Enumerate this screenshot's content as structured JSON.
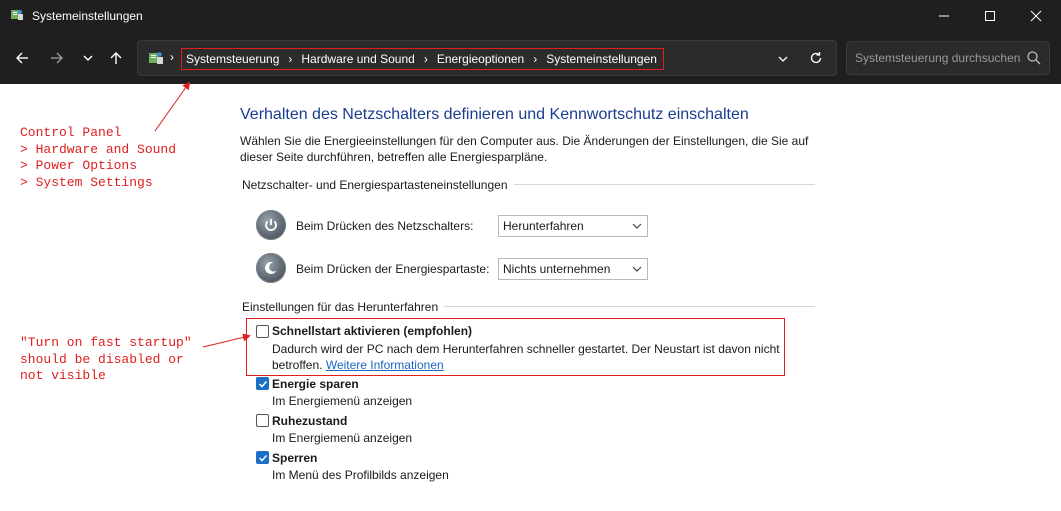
{
  "window": {
    "title": "Systemeinstellungen"
  },
  "address": {
    "crumbs": [
      "Systemsteuerung",
      "Hardware und Sound",
      "Energieoptionen",
      "Systemeinstellungen"
    ],
    "search_placeholder": "Systemsteuerung durchsuchen"
  },
  "annotations": {
    "breadcrumb_note": "Control Panel\n> Hardware and Sound\n> Power Options\n> System Settings",
    "fast_startup_note": "\"Turn on fast startup\"\nshould be disabled or\nnot visible",
    "color": "#e01e1e"
  },
  "main": {
    "heading": "Verhalten des Netzschalters definieren und Kennwortschutz einschalten",
    "description": "Wählen Sie die Energieeinstellungen für den Computer aus. Die Änderungen der Einstellungen, die Sie auf dieser Seite durchführen, betreffen alle Energiesparpläne.",
    "buttons_section": {
      "title": "Netzschalter- und Energiespartasteneinstellungen",
      "rows": [
        {
          "label": "Beim Drücken des Netzschalters:",
          "value": "Herunterfahren",
          "icon": "power-button-icon"
        },
        {
          "label": "Beim Drücken der Energiespartaste:",
          "value": "Nichts unternehmen",
          "icon": "sleep-button-icon"
        }
      ]
    },
    "shutdown_section": {
      "title": "Einstellungen für das Herunterfahren",
      "options": [
        {
          "title": "Schnellstart aktivieren (empfohlen)",
          "desc": "Dadurch wird der PC nach dem Herunterfahren schneller gestartet. Der Neustart ist davon nicht betroffen.",
          "link": "Weitere Informationen",
          "checked": false
        },
        {
          "title": "Energie sparen",
          "desc": "Im Energiemenü anzeigen",
          "checked": true
        },
        {
          "title": "Ruhezustand",
          "desc": "Im Energiemenü anzeigen",
          "checked": false
        },
        {
          "title": "Sperren",
          "desc": "Im Menü des Profilbilds anzeigen",
          "checked": true
        }
      ]
    }
  },
  "colors": {
    "accent": "#1a6fc4",
    "heading": "#1a3d8f",
    "annotation": "#e01e1e",
    "chrome": "#1f1f1f"
  }
}
